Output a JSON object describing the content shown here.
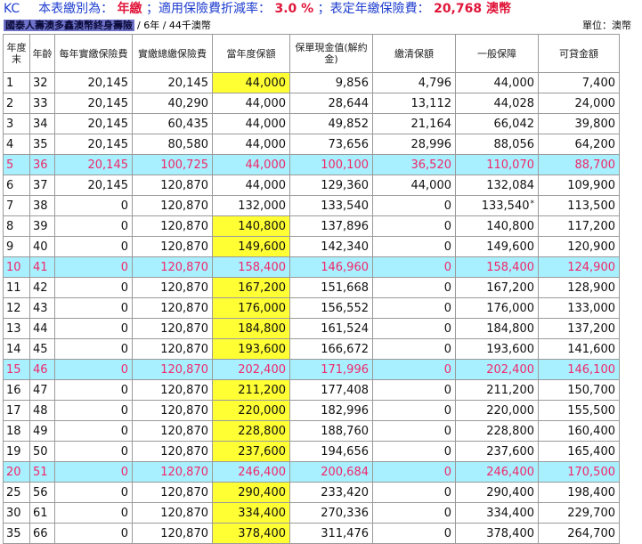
{
  "header": {
    "code": "KC",
    "pay_type_label": "本表繳別為：",
    "pay_type": "年繳",
    "discount_label": "；適用保險費折減率：",
    "discount": "3.0 %",
    "premium_label": "；表定年繳保險費：",
    "premium": "20,768 澳幣",
    "product": "國泰人壽澳多鑫澳幣終身壽險",
    "plan": "/ 6年 / 44千澳幣",
    "unit": "單位：澳幣"
  },
  "columns": [
    "年度末",
    "年齡",
    "每年實繳保險費",
    "實繳總繳保險費",
    "當年度保額",
    "保單現金值(解約金)",
    "繳清保額",
    "一般保障",
    "可貸金額"
  ],
  "rows": [
    [
      "1",
      "32",
      "20,145",
      "20,145",
      "44,000",
      "9,856",
      "4,796",
      "44,000",
      "7,400"
    ],
    [
      "2",
      "33",
      "20,145",
      "40,290",
      "44,000",
      "28,644",
      "13,112",
      "44,028",
      "24,000"
    ],
    [
      "3",
      "34",
      "20,145",
      "60,435",
      "44,000",
      "49,852",
      "21,164",
      "66,042",
      "39,800"
    ],
    [
      "4",
      "35",
      "20,145",
      "80,580",
      "44,000",
      "73,656",
      "28,996",
      "88,056",
      "64,200"
    ],
    [
      "5",
      "36",
      "20,145",
      "100,725",
      "44,000",
      "100,100",
      "36,520",
      "110,070",
      "88,700"
    ],
    [
      "6",
      "37",
      "20,145",
      "120,870",
      "44,000",
      "129,360",
      "44,000",
      "132,084",
      "109,900"
    ],
    [
      "7",
      "38",
      "0",
      "120,870",
      "132,000",
      "133,540",
      "0",
      "133,540",
      "113,500"
    ],
    [
      "8",
      "39",
      "0",
      "120,870",
      "140,800",
      "137,896",
      "0",
      "140,800",
      "117,200"
    ],
    [
      "9",
      "40",
      "0",
      "120,870",
      "149,600",
      "142,340",
      "0",
      "149,600",
      "120,900"
    ],
    [
      "10",
      "41",
      "0",
      "120,870",
      "158,400",
      "146,960",
      "0",
      "158,400",
      "124,900"
    ],
    [
      "11",
      "42",
      "0",
      "120,870",
      "167,200",
      "151,668",
      "0",
      "167,200",
      "128,900"
    ],
    [
      "12",
      "43",
      "0",
      "120,870",
      "176,000",
      "156,552",
      "0",
      "176,000",
      "133,000"
    ],
    [
      "13",
      "44",
      "0",
      "120,870",
      "184,800",
      "161,524",
      "0",
      "184,800",
      "137,200"
    ],
    [
      "14",
      "45",
      "0",
      "120,870",
      "193,600",
      "166,672",
      "0",
      "193,600",
      "141,600"
    ],
    [
      "15",
      "46",
      "0",
      "120,870",
      "202,400",
      "171,996",
      "0",
      "202,400",
      "146,100"
    ],
    [
      "16",
      "47",
      "0",
      "120,870",
      "211,200",
      "177,408",
      "0",
      "211,200",
      "150,700"
    ],
    [
      "17",
      "48",
      "0",
      "120,870",
      "220,000",
      "182,996",
      "0",
      "220,000",
      "155,500"
    ],
    [
      "18",
      "49",
      "0",
      "120,870",
      "228,800",
      "188,760",
      "0",
      "228,800",
      "160,400"
    ],
    [
      "19",
      "50",
      "0",
      "120,870",
      "237,600",
      "194,656",
      "0",
      "237,600",
      "165,400"
    ],
    [
      "20",
      "51",
      "0",
      "120,870",
      "246,400",
      "200,684",
      "0",
      "246,400",
      "170,500"
    ],
    [
      "25",
      "56",
      "0",
      "120,870",
      "290,400",
      "233,420",
      "0",
      "290,400",
      "198,400"
    ],
    [
      "30",
      "61",
      "0",
      "120,870",
      "334,400",
      "270,336",
      "0",
      "334,400",
      "229,700"
    ],
    [
      "35",
      "66",
      "0",
      "120,870",
      "378,400",
      "311,476",
      "0",
      "378,400",
      "264,700"
    ]
  ],
  "highlight_rows": [
    4,
    9,
    14,
    19
  ],
  "yellow_rows": [
    0,
    7,
    8,
    9,
    10,
    11,
    12,
    13,
    14,
    15,
    16,
    17,
    18,
    19,
    20,
    21,
    22
  ],
  "star_mark": "*",
  "star_row": 6,
  "colors": {
    "highlight_row": "#a8f0ff",
    "highlight_text": "#f0286a",
    "yellow_cell": "#ffff33",
    "title_blue": "#1f3ecf",
    "title_red": "#e0163a",
    "product_bg": "#6e72c8"
  }
}
